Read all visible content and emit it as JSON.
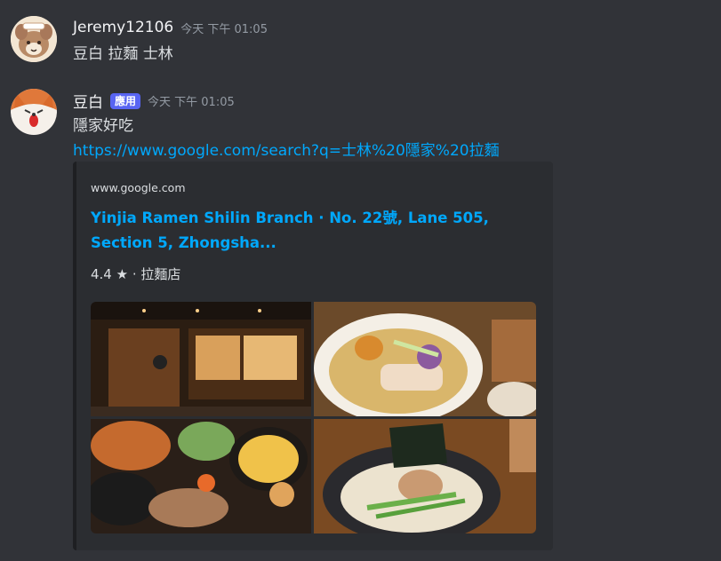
{
  "messages": [
    {
      "username": "Jeremy12106",
      "timestamp": "今天 下午 01:05",
      "text": "豆白 拉麵 士林"
    },
    {
      "username": "豆白",
      "badge": "應用",
      "timestamp": "今天 下午 01:05",
      "text": "隱家好吃",
      "link": "https://www.google.com/search?q=士林%20隱家%20拉麵",
      "embed": {
        "provider": "www.google.com",
        "title": "Yinjia Ramen Shilin Branch · No. 22號, Lane 505, Section 5, Zhongsha...",
        "description": "4.4 ★ · 拉麵店"
      }
    }
  ],
  "colors": {
    "background": "#313338",
    "link": "#00a8fc",
    "badge": "#5865f2",
    "embed_bg": "#2b2d31"
  }
}
